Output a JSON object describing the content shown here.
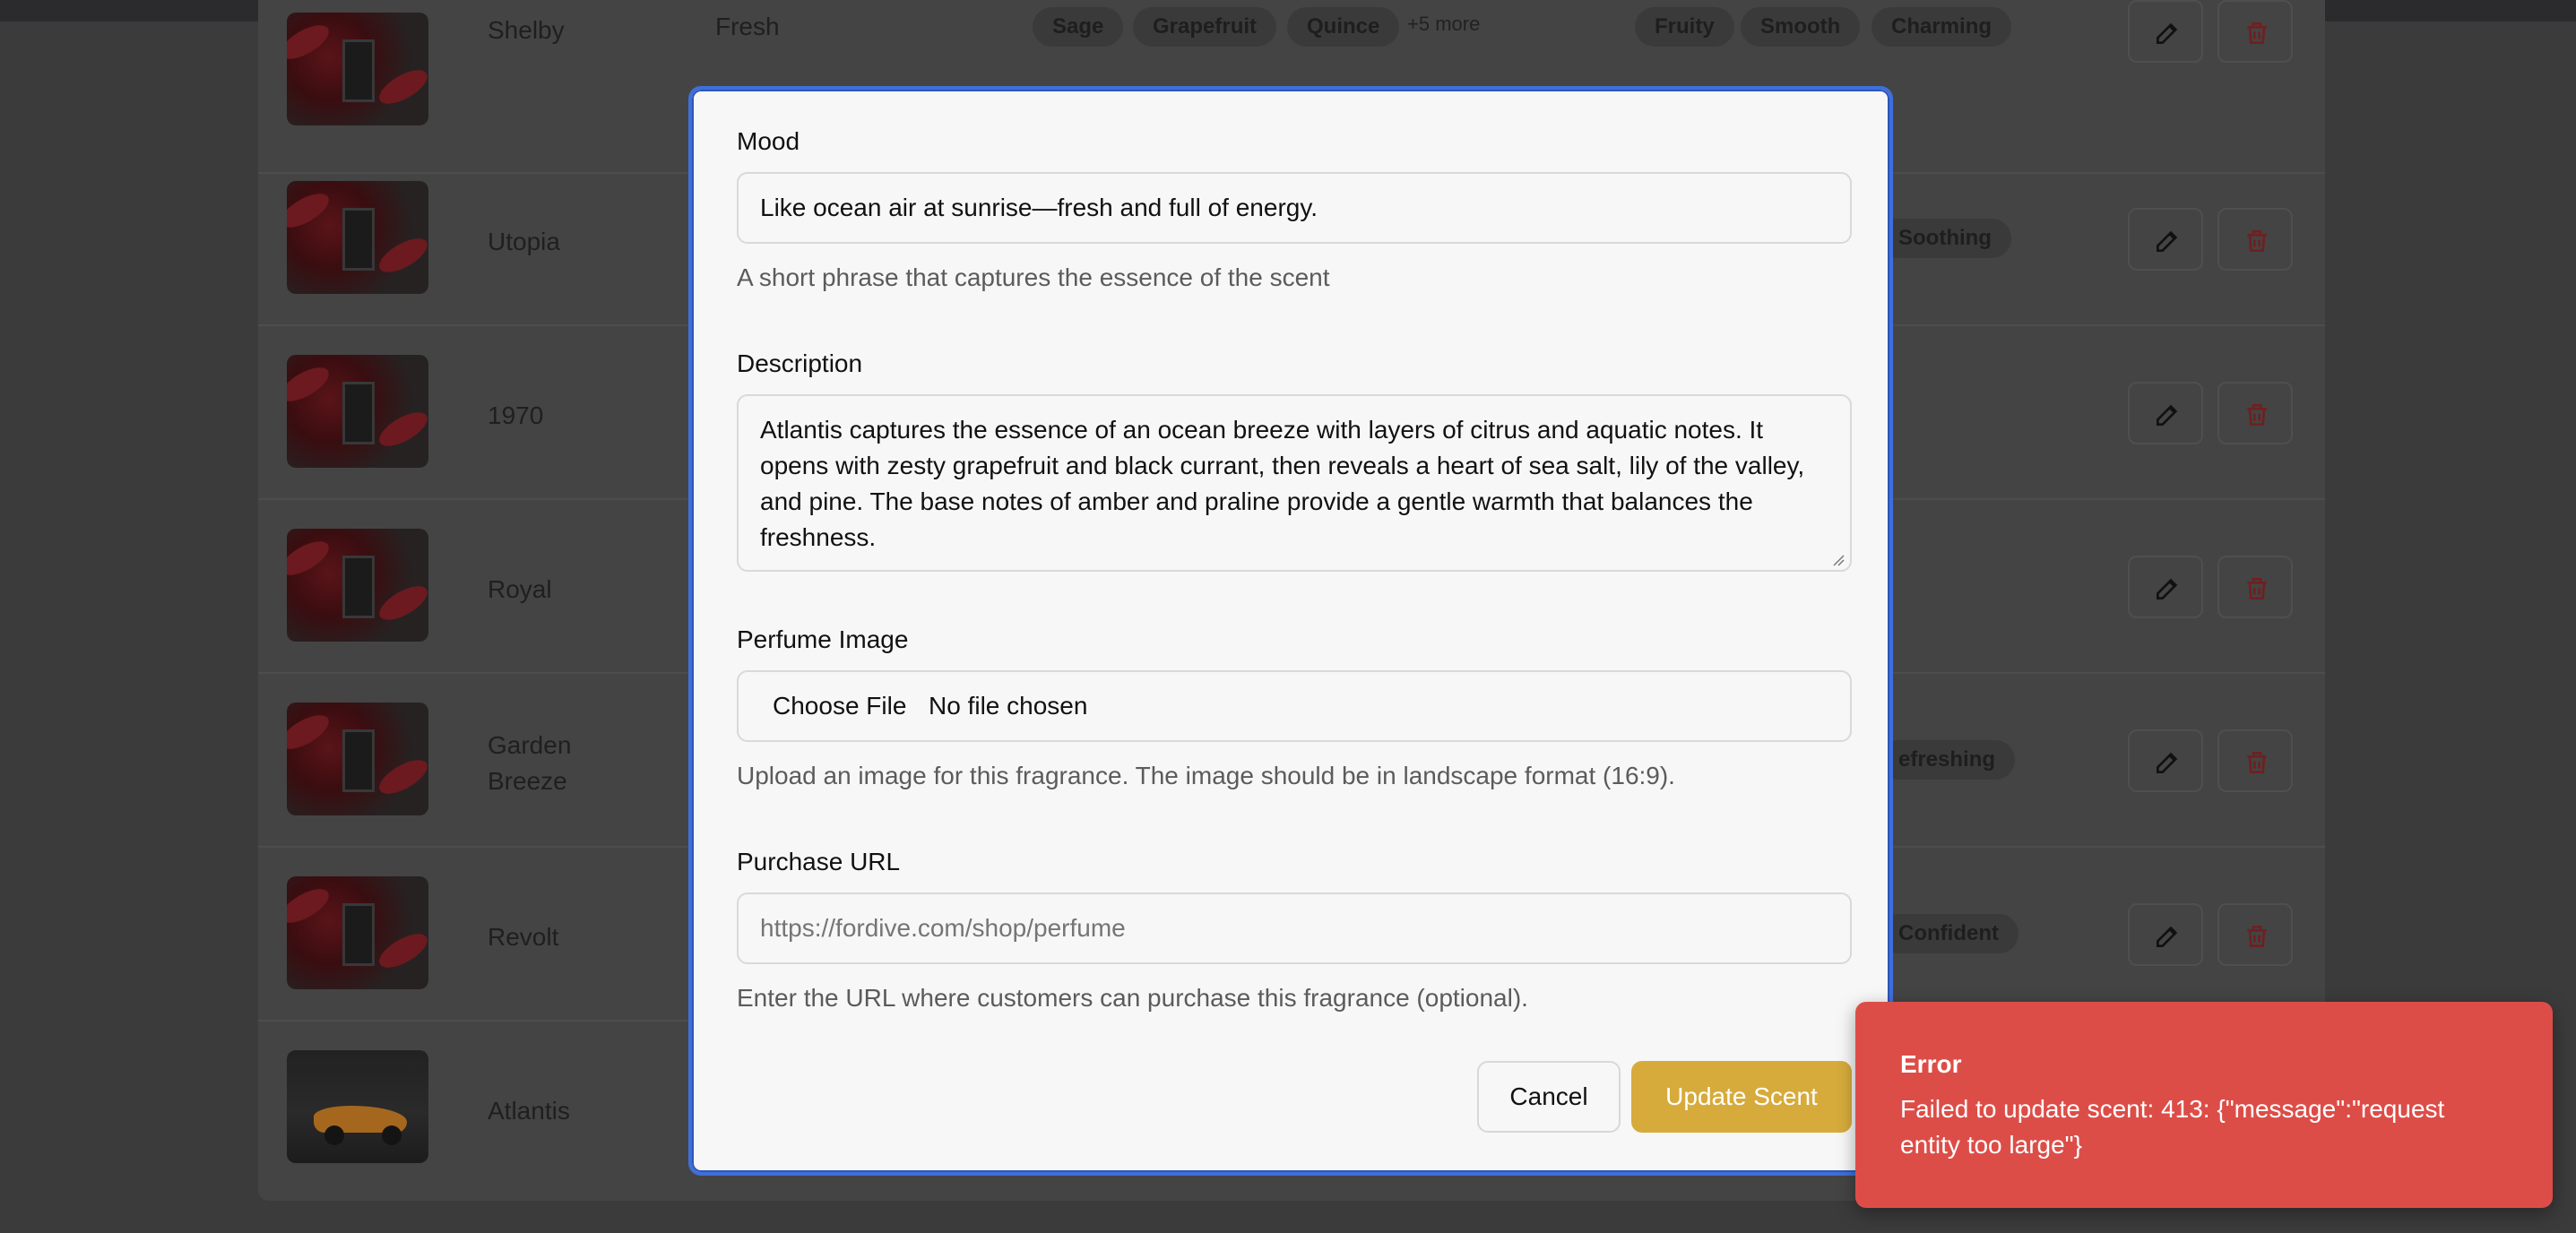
{
  "colors": {
    "modal_border": "#3f6fd8",
    "primary_button": "#d6ab3c",
    "toast_background": "#dd4d48",
    "delete_icon": "#7a1f1f"
  },
  "background_table": {
    "rows": [
      {
        "name": "Shelby",
        "type": "Fresh",
        "notes": [
          "Sage",
          "Grapefruit",
          "Quince"
        ],
        "notes_more": "+5 more",
        "moods": [
          "Fruity",
          "Smooth",
          "Charming"
        ]
      },
      {
        "name": "Utopia",
        "moods": [
          "Soothing"
        ]
      },
      {
        "name": "1970"
      },
      {
        "name": "Royal"
      },
      {
        "name": "Garden Breeze",
        "moods": [
          "efreshing"
        ]
      },
      {
        "name": "Revolt",
        "moods": [
          "Confident"
        ]
      },
      {
        "name": "Atlantis"
      }
    ],
    "edit_icon": "edit-icon",
    "delete_icon": "trash-icon"
  },
  "modal": {
    "mood": {
      "label": "Mood",
      "value": "Like ocean air at sunrise—fresh and full of energy.",
      "hint": "A short phrase that captures the essence of the scent"
    },
    "description": {
      "label": "Description",
      "value": "Atlantis captures the essence of an ocean breeze with layers of citrus and aquatic notes. It opens with zesty grapefruit and black currant, then reveals a heart of sea salt, lily of the valley, and pine. The base notes of amber and praline provide a gentle warmth that balances the freshness."
    },
    "image": {
      "label": "Perfume Image",
      "choose_button": "Choose File",
      "status": "No file chosen",
      "hint": "Upload an image for this fragrance. The image should be in landscape format (16:9)."
    },
    "purchase_url": {
      "label": "Purchase URL",
      "placeholder": "https://fordive.com/shop/perfume",
      "hint": "Enter the URL where customers can purchase this fragrance (optional)."
    },
    "buttons": {
      "cancel": "Cancel",
      "update": "Update Scent"
    }
  },
  "toast": {
    "title": "Error",
    "message": "Failed to update scent: 413: {\"message\":\"request entity too large\"}"
  }
}
